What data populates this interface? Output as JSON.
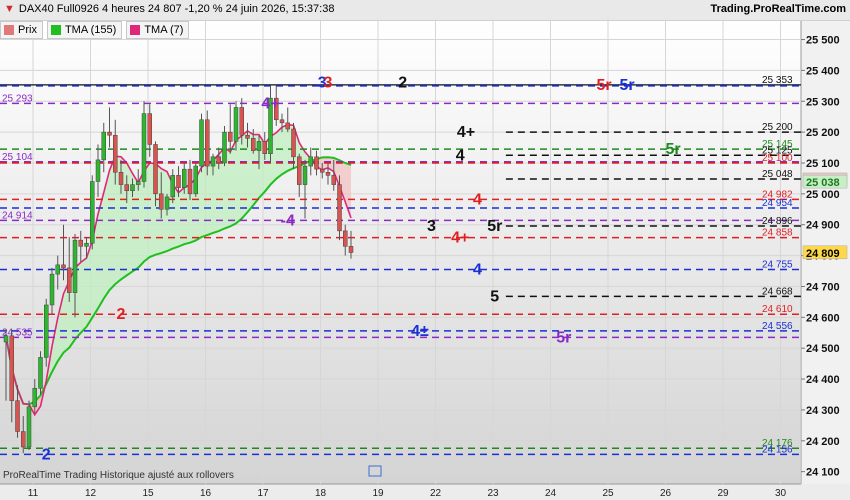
{
  "header": {
    "title": "DAX40 Full0926 4 heures 24 807 -1,20 % 24 juin 2026, 15:37:38",
    "site": "Trading.ProRealTime.com"
  },
  "legend": [
    {
      "label": "Prix",
      "color": "#e07a7a"
    },
    {
      "label": "TMA (155)",
      "color": "#1fbf1f"
    },
    {
      "label": "TMA (7)",
      "color": "#e0287a"
    }
  ],
  "footer": "ProRealTime Trading  Historique ajusté aux rollovers",
  "chart_data": {
    "type": "candlestick",
    "y_ticks": [
      24100,
      24200,
      24300,
      24400,
      24500,
      24600,
      24700,
      24800,
      24900,
      25000,
      25100,
      25200,
      25300,
      25400,
      25500
    ],
    "y_tick_labels": [
      "24 100",
      "24 200",
      "24 300",
      "24 400",
      "24 500",
      "24 600",
      "24 700",
      "24 800",
      "24 900",
      "25 000",
      "25 100",
      "25 200",
      "25 300",
      "25 400",
      "25 500"
    ],
    "ylim": [
      24060,
      25560
    ],
    "x_labels": [
      {
        "label": "11",
        "idx": 0
      },
      {
        "label": "12",
        "idx": 10
      },
      {
        "label": "15",
        "idx": 20
      },
      {
        "label": "16",
        "idx": 30
      },
      {
        "label": "17",
        "idx": 40
      },
      {
        "label": "18",
        "idx": 50
      },
      {
        "label": "19",
        "idx": 60
      },
      {
        "label": "22",
        "idx": 70
      },
      {
        "label": "23",
        "idx": 80
      },
      {
        "label": "24",
        "idx": 90
      },
      {
        "label": "25",
        "idx": 100
      },
      {
        "label": "26",
        "idx": 110
      },
      {
        "label": "29",
        "idx": 120
      },
      {
        "label": "30",
        "idx": 130
      }
    ],
    "candles": [
      [
        24520,
        24560,
        24330,
        24540
      ],
      [
        24540,
        24560,
        24260,
        24330
      ],
      [
        24330,
        24380,
        24210,
        24230
      ],
      [
        24230,
        24280,
        24160,
        24180
      ],
      [
        24180,
        24330,
        24170,
        24310
      ],
      [
        24310,
        24400,
        24290,
        24370
      ],
      [
        24370,
        24490,
        24350,
        24470
      ],
      [
        24470,
        24660,
        24440,
        24640
      ],
      [
        24640,
        24760,
        24610,
        24740
      ],
      [
        24740,
        24800,
        24690,
        24770
      ],
      [
        24770,
        24900,
        24720,
        24760
      ],
      [
        24760,
        24860,
        24650,
        24680
      ],
      [
        24680,
        24870,
        24600,
        24850
      ],
      [
        24850,
        24880,
        24780,
        24830
      ],
      [
        24830,
        24860,
        24790,
        24840
      ],
      [
        24840,
        25060,
        24820,
        25040
      ],
      [
        25040,
        25160,
        24990,
        25110
      ],
      [
        25110,
        25230,
        25070,
        25200
      ],
      [
        25200,
        25280,
        25150,
        25190
      ],
      [
        25190,
        25240,
        25030,
        25070
      ],
      [
        25070,
        25110,
        25000,
        25030
      ],
      [
        25030,
        25060,
        24970,
        25010
      ],
      [
        25010,
        25050,
        24990,
        25030
      ],
      [
        25030,
        25080,
        25010,
        25040
      ],
      [
        25040,
        25300,
        25020,
        25260
      ],
      [
        25260,
        25290,
        25120,
        25160
      ],
      [
        25160,
        25170,
        24960,
        25000
      ],
      [
        25000,
        25070,
        24920,
        24950
      ],
      [
        24950,
        25000,
        24930,
        24990
      ],
      [
        24990,
        25080,
        24970,
        25060
      ],
      [
        25060,
        25090,
        24990,
        25020
      ],
      [
        25020,
        25100,
        25000,
        25080
      ],
      [
        25080,
        25110,
        24980,
        25000
      ],
      [
        25000,
        25100,
        24990,
        25090
      ],
      [
        25090,
        25260,
        25070,
        25240
      ],
      [
        25240,
        25270,
        25060,
        25090
      ],
      [
        25090,
        25130,
        25060,
        25120
      ],
      [
        25120,
        25150,
        25080,
        25100
      ],
      [
        25100,
        25220,
        25090,
        25200
      ],
      [
        25200,
        25290,
        25130,
        25170
      ],
      [
        25170,
        25300,
        25140,
        25280
      ],
      [
        25280,
        25310,
        25160,
        25190
      ],
      [
        25190,
        25230,
        25150,
        25180
      ],
      [
        25180,
        25210,
        25130,
        25140
      ],
      [
        25140,
        25190,
        25080,
        25170
      ],
      [
        25170,
        25200,
        25110,
        25130
      ],
      [
        25130,
        25350,
        25100,
        25310
      ],
      [
        25310,
        25350,
        25220,
        25240
      ],
      [
        25240,
        25260,
        25200,
        25230
      ],
      [
        25230,
        25280,
        25200,
        25210
      ],
      [
        25210,
        25230,
        25080,
        25120
      ],
      [
        25120,
        25130,
        24990,
        25030
      ],
      [
        25030,
        25110,
        24920,
        25090
      ],
      [
        25090,
        25150,
        25060,
        25120
      ],
      [
        25120,
        25140,
        25060,
        25080
      ],
      [
        25080,
        25100,
        25050,
        25070
      ],
      [
        25070,
        25100,
        25030,
        25060
      ],
      [
        25060,
        25110,
        25010,
        25030
      ],
      [
        25030,
        25060,
        24850,
        24880
      ],
      [
        24880,
        24900,
        24800,
        24830
      ],
      [
        24830,
        24880,
        24790,
        24810
      ]
    ],
    "levels": [
      {
        "price": 25353,
        "color": "#111111",
        "style": "solid",
        "label": "25 353",
        "side": "right"
      },
      {
        "price": 25350,
        "color": "#1a2fd6",
        "style": "dash"
      },
      {
        "price": 25293,
        "color": "#8a2bc4",
        "style": "dash",
        "label": "25 293",
        "side": "left"
      },
      {
        "price": 25200,
        "color": "#111111",
        "style": "dash",
        "label": "25 200",
        "side": "right",
        "start": 0.63
      },
      {
        "price": 25145,
        "color": "#1d8a1d",
        "style": "dash",
        "label": "25 145",
        "side": "right"
      },
      {
        "price": 25125,
        "color": "#111111",
        "style": "dash",
        "label": "25 125",
        "side": "right",
        "start": 0.63
      },
      {
        "price": 25104,
        "color": "#8a2bc4",
        "style": "dash",
        "label": "25 104",
        "side": "left"
      },
      {
        "price": 25100,
        "color": "#e02020",
        "style": "dash",
        "label": "25 100",
        "side": "right"
      },
      {
        "price": 25048,
        "color": "#111111",
        "style": "dash",
        "label": "25 048",
        "side": "right",
        "start": 0.63
      },
      {
        "price": 24982,
        "color": "#e02020",
        "style": "dash",
        "label": "24 982",
        "side": "right"
      },
      {
        "price": 24954,
        "color": "#1a2fd6",
        "style": "dash",
        "label": "24 954",
        "side": "right"
      },
      {
        "price": 24914,
        "color": "#8a2bc4",
        "style": "dash",
        "label": "24 914",
        "side": "left"
      },
      {
        "price": 24896,
        "color": "#111111",
        "style": "dash",
        "label": "24 896",
        "side": "right",
        "start": 0.63
      },
      {
        "price": 24858,
        "color": "#e02020",
        "style": "dash",
        "label": "24 858",
        "side": "right"
      },
      {
        "price": 24755,
        "color": "#1a2fd6",
        "style": "dash",
        "label": "24 755",
        "side": "right"
      },
      {
        "price": 24668,
        "color": "#111111",
        "style": "dash",
        "label": "24 668",
        "side": "right",
        "start": 0.63
      },
      {
        "price": 24610,
        "color": "#e02020",
        "style": "dash",
        "label": "24 610",
        "side": "right"
      },
      {
        "price": 24556,
        "color": "#1a2fd6",
        "style": "dash",
        "label": "24 556",
        "side": "right"
      },
      {
        "price": 24535,
        "color": "#8a2bc4",
        "style": "dash",
        "label": "24 535",
        "side": "left"
      },
      {
        "price": 24176,
        "color": "#1d8a1d",
        "style": "dash",
        "label": "24 176",
        "side": "right"
      },
      {
        "price": 24156,
        "color": "#1a2fd6",
        "style": "dash",
        "label": "24 156",
        "side": "right"
      }
    ],
    "price_tags": [
      {
        "price": 25045,
        "label": "25 045",
        "bg": "#f2c4c4",
        "fg": "#c03030"
      },
      {
        "price": 25038,
        "label": "25 038",
        "bg": "#c8eec8",
        "fg": "#1a7a1a"
      },
      {
        "price": 24809,
        "label": "24 809",
        "bg": "#ffd84a",
        "fg": "#000000"
      }
    ],
    "annotations": [
      {
        "text": "3",
        "color": "#1a2fd6",
        "idx": 55,
        "price": 25360
      },
      {
        "text": "3",
        "color": "#e02020",
        "idx": 56,
        "price": 25360
      },
      {
        "text": "2",
        "color": "#111111",
        "idx": 69,
        "price": 25360
      },
      {
        "text": "5r",
        "color": "#e02020",
        "idx": 104,
        "price": 25353
      },
      {
        "text": "5r",
        "color": "#1a2fd6",
        "idx": 108,
        "price": 25353
      },
      {
        "text": "4+",
        "color": "#8a2bc4",
        "idx": 46,
        "price": 25293
      },
      {
        "text": "4+",
        "color": "#111111",
        "idx": 80,
        "price": 25200
      },
      {
        "text": "5r",
        "color": "#1d8a1d",
        "idx": 116,
        "price": 25145
      },
      {
        "text": "4",
        "color": "#111111",
        "idx": 79,
        "price": 25125
      },
      {
        "text": "4",
        "color": "#e02020",
        "idx": 82,
        "price": 24982
      },
      {
        "text": "-4",
        "color": "#8a2bc4",
        "idx": 49,
        "price": 24914
      },
      {
        "text": "3",
        "color": "#111111",
        "idx": 74,
        "price": 24896
      },
      {
        "text": "5r",
        "color": "#111111",
        "idx": 85,
        "price": 24896
      },
      {
        "text": "4+",
        "color": "#e02020",
        "idx": 79,
        "price": 24858
      },
      {
        "text": "4",
        "color": "#1a2fd6",
        "idx": 82,
        "price": 24755
      },
      {
        "text": "5",
        "color": "#111111",
        "idx": 85,
        "price": 24668
      },
      {
        "text": "2",
        "color": "#e02020",
        "idx": 20,
        "price": 24610
      },
      {
        "text": "4±",
        "color": "#1a2fd6",
        "idx": 72,
        "price": 24556
      },
      {
        "text": "5r",
        "color": "#8a2bc4",
        "idx": 97,
        "price": 24535
      },
      {
        "text": "2",
        "color": "#1a2fd6",
        "idx": 7,
        "price": 24156
      }
    ]
  }
}
